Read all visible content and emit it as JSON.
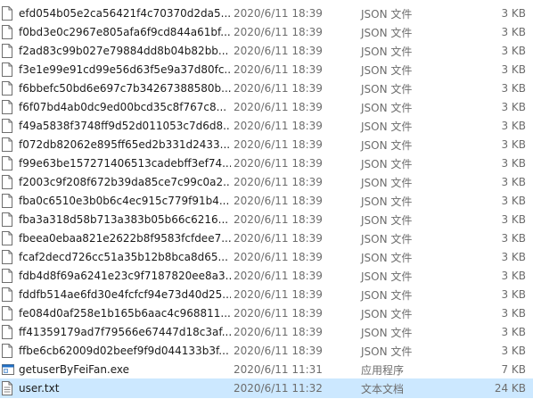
{
  "files": [
    {
      "name": "efd054b05e2ca56421f4c70370d2da5...",
      "date": "2020/6/11 18:39",
      "type": "JSON 文件",
      "size": "3 KB",
      "icon": "json-file-icon"
    },
    {
      "name": "f0bd3e0c2967e805afa6f9cd844a61bf...",
      "date": "2020/6/11 18:39",
      "type": "JSON 文件",
      "size": "3 KB",
      "icon": "json-file-icon"
    },
    {
      "name": "f2ad83c99b027e79884dd8b04b82bb...",
      "date": "2020/6/11 18:39",
      "type": "JSON 文件",
      "size": "3 KB",
      "icon": "json-file-icon"
    },
    {
      "name": "f3e1e99e91cd99e56d63f5e9a37d80fc...",
      "date": "2020/6/11 18:39",
      "type": "JSON 文件",
      "size": "3 KB",
      "icon": "json-file-icon"
    },
    {
      "name": "f6bbefc50bd6e697c7b34267388580b...",
      "date": "2020/6/11 18:39",
      "type": "JSON 文件",
      "size": "3 KB",
      "icon": "json-file-icon"
    },
    {
      "name": "f6f07bd4ab0dc9ed00bcd35c8f767c8...",
      "date": "2020/6/11 18:39",
      "type": "JSON 文件",
      "size": "3 KB",
      "icon": "json-file-icon"
    },
    {
      "name": "f49a5838f3748ff9d52d011053c7d6d8...",
      "date": "2020/6/11 18:39",
      "type": "JSON 文件",
      "size": "3 KB",
      "icon": "json-file-icon"
    },
    {
      "name": "f072db82062e895ff65ed2b331d2433...",
      "date": "2020/6/11 18:39",
      "type": "JSON 文件",
      "size": "3 KB",
      "icon": "json-file-icon"
    },
    {
      "name": "f99e63be157271406513cadebff3ef74...",
      "date": "2020/6/11 18:39",
      "type": "JSON 文件",
      "size": "3 KB",
      "icon": "json-file-icon"
    },
    {
      "name": "f2003c9f208f672b39da85ce7c99c0a2...",
      "date": "2020/6/11 18:39",
      "type": "JSON 文件",
      "size": "3 KB",
      "icon": "json-file-icon"
    },
    {
      "name": "fba0c6510e3b0b6c4ec915c779f91b4...",
      "date": "2020/6/11 18:39",
      "type": "JSON 文件",
      "size": "3 KB",
      "icon": "json-file-icon"
    },
    {
      "name": "fba3a318d58b713a383b05b66c6216...",
      "date": "2020/6/11 18:39",
      "type": "JSON 文件",
      "size": "3 KB",
      "icon": "json-file-icon"
    },
    {
      "name": "fbeea0ebaa821e2622b8f9583fcfdee7...",
      "date": "2020/6/11 18:39",
      "type": "JSON 文件",
      "size": "3 KB",
      "icon": "json-file-icon"
    },
    {
      "name": "fcaf2decd726cc51a35b12b8bca8d65...",
      "date": "2020/6/11 18:39",
      "type": "JSON 文件",
      "size": "3 KB",
      "icon": "json-file-icon"
    },
    {
      "name": "fdb4d8f69a6241e23c9f7187820ee8a3...",
      "date": "2020/6/11 18:39",
      "type": "JSON 文件",
      "size": "3 KB",
      "icon": "json-file-icon"
    },
    {
      "name": "fddfb514ae6fd30e4fcfcf94e73d40d25...",
      "date": "2020/6/11 18:39",
      "type": "JSON 文件",
      "size": "3 KB",
      "icon": "json-file-icon"
    },
    {
      "name": "fe084d0af258e1b165b6aac4c968811...",
      "date": "2020/6/11 18:39",
      "type": "JSON 文件",
      "size": "3 KB",
      "icon": "json-file-icon"
    },
    {
      "name": "ff41359179ad7f79566e67447d18c3af...",
      "date": "2020/6/11 18:39",
      "type": "JSON 文件",
      "size": "3 KB",
      "icon": "json-file-icon"
    },
    {
      "name": "ffbe6cb62009d02beef9f9d044133b3f...",
      "date": "2020/6/11 18:39",
      "type": "JSON 文件",
      "size": "3 KB",
      "icon": "json-file-icon"
    },
    {
      "name": "getuserByFeiFan.exe",
      "date": "2020/6/11 11:31",
      "type": "应用程序",
      "size": "7 KB",
      "icon": "exe-file-icon"
    },
    {
      "name": "user.txt",
      "date": "2020/6/11 11:32",
      "type": "文本文档",
      "size": "24 KB",
      "icon": "txt-file-icon"
    }
  ],
  "selected_index": 20,
  "colors": {
    "selection": "#cce8ff",
    "icon_outline": "#6e6e6e",
    "exe_accent": "#1f6fc5"
  }
}
